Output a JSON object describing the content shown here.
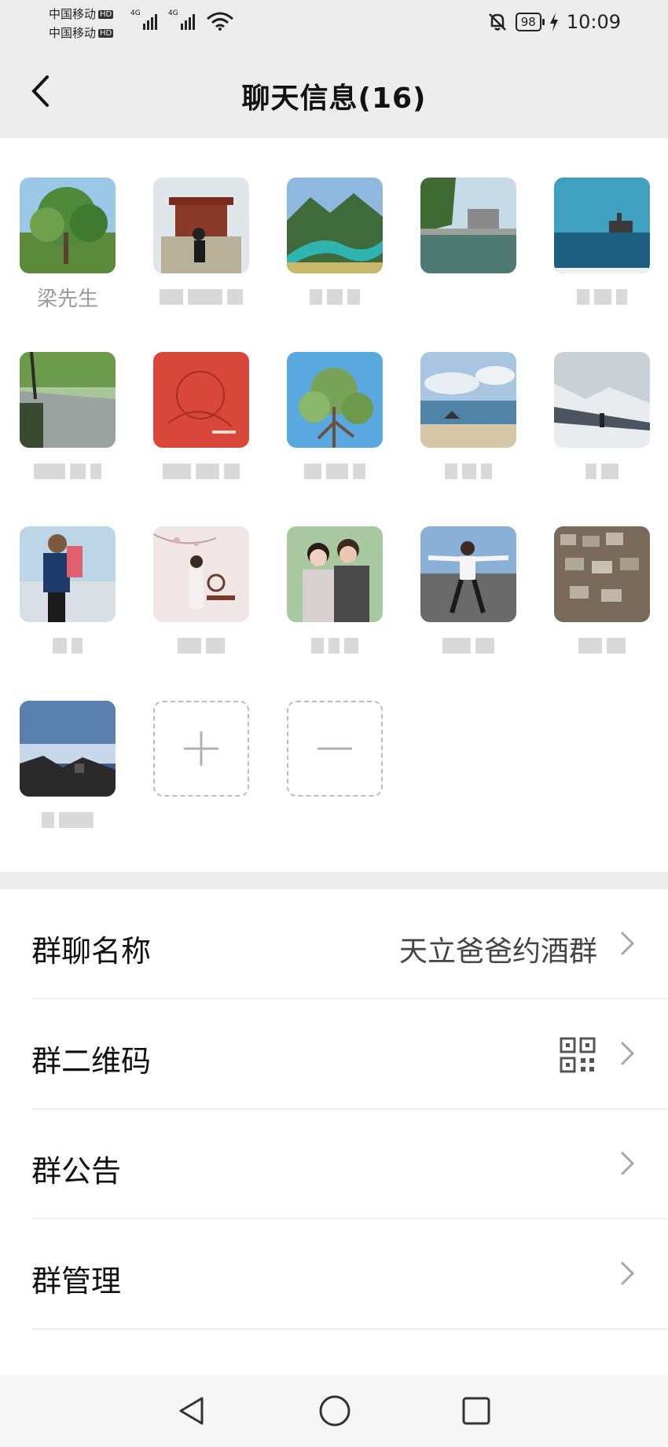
{
  "status_bar": {
    "carrier_1": "中国移动",
    "carrier_2": "中国移动",
    "hd": "HD",
    "network": "4G",
    "battery": "98",
    "time": "10:09"
  },
  "header": {
    "title": "聊天信息(16)"
  },
  "members": [
    {
      "name": "梁先生",
      "visible_name": true
    },
    {
      "name": "",
      "visible_name": false
    },
    {
      "name": "",
      "visible_name": false
    },
    {
      "name": "",
      "visible_name": false
    },
    {
      "name": "",
      "visible_name": false
    },
    {
      "name": "",
      "visible_name": false
    },
    {
      "name": "",
      "visible_name": false
    },
    {
      "name": "",
      "visible_name": false
    },
    {
      "name": "",
      "visible_name": false
    },
    {
      "name": "",
      "visible_name": false
    },
    {
      "name": "",
      "visible_name": false
    },
    {
      "name": "",
      "visible_name": false
    },
    {
      "name": "",
      "visible_name": false
    },
    {
      "name": "",
      "visible_name": false
    },
    {
      "name": "",
      "visible_name": false
    },
    {
      "name": "",
      "visible_name": false
    }
  ],
  "actions": {
    "add": "+",
    "remove": "−"
  },
  "settings": {
    "group_name_label": "群聊名称",
    "group_name_value": "天立爸爸约酒群",
    "qr_label": "群二维码",
    "notice_label": "群公告",
    "manage_label": "群管理"
  },
  "colors": {
    "background": "#ededed",
    "panel": "#ffffff",
    "secondary_text": "#9a9a9a"
  }
}
